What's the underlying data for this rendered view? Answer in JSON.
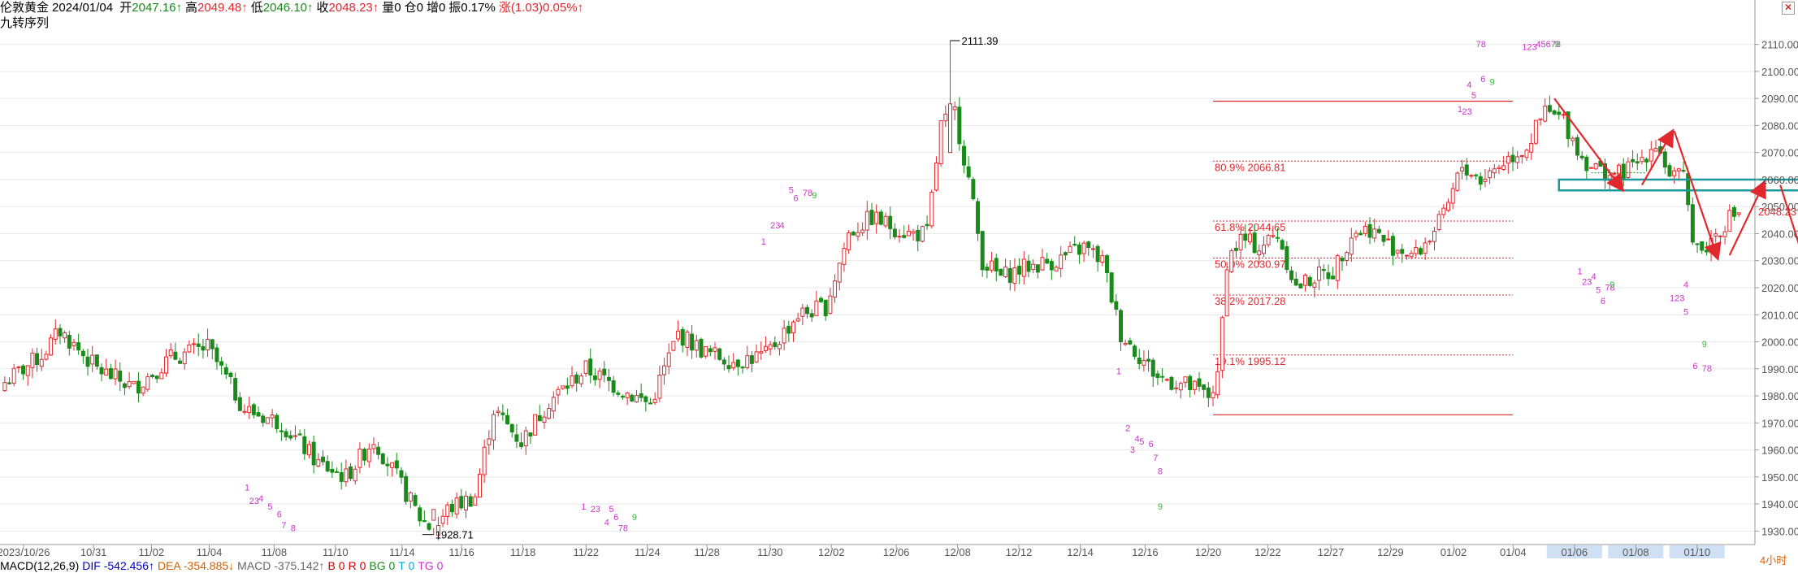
{
  "header": {
    "symbol": "伦敦黄金",
    "date": "2024/01/04",
    "open_label": "开",
    "open": "2047.16↑",
    "high_label": "高",
    "high": "2049.48↑",
    "low_label": "低",
    "low": "2046.10↑",
    "close_label": "收",
    "close": "2048.23↑",
    "volume": "量0",
    "oi": "仓0",
    "oi_change": "增0",
    "amplitude": "振0.17%",
    "change": "涨(1.03)0.05%↑"
  },
  "subtitle": "九转序列",
  "close_icon": "close-icon",
  "period_label": "4小时",
  "macd": {
    "title": "MACD(12,26,9)",
    "dif": "DIF -542.456↑",
    "dea": "DEA -354.885↓",
    "macd": "MACD -375.142↑",
    "b": "B 0",
    "r": "R 0",
    "bg": "BG 0",
    "t": "T 0",
    "tg": "TG 0"
  },
  "colors": {
    "up": "#e0282e",
    "down": "#1a8a1a",
    "fib": "#e0282e",
    "seq": "#cc33cc",
    "nine": "#33bb33",
    "box": "#1a9a9a",
    "price_tag": "#e0282e",
    "axis_text": "#555555"
  },
  "chart_data": {
    "type": "candlestick",
    "ylim": [
      1925,
      2118
    ],
    "y_ticks": [
      1930,
      1940,
      1950,
      1960,
      1970,
      1980,
      1990,
      2000,
      2010,
      2020,
      2030,
      2040,
      2050,
      2060,
      2070,
      2080,
      2090,
      2100,
      2110
    ],
    "x_ticks": [
      "2023/10/26",
      "10/31",
      "11/02",
      "11/04",
      "11/08",
      "11/10",
      "11/14",
      "11/16",
      "11/18",
      "11/22",
      "11/24",
      "11/28",
      "11/30",
      "12/02",
      "12/06",
      "12/08",
      "12/12",
      "12/14",
      "12/16",
      "12/20",
      "12/22",
      "12/27",
      "12/29",
      "01/02",
      "01/04",
      "01/06",
      "01/08",
      "01/10"
    ],
    "future_ticks": [
      "01/06",
      "01/08",
      "01/10"
    ],
    "last_price": "2048.23",
    "annotations": {
      "high": "2111.39",
      "low": "1928.71"
    },
    "fib_levels": [
      {
        "label": "80.9% 2066.81",
        "value": 2066.81
      },
      {
        "label": "61.8% 2044.65",
        "value": 2044.65
      },
      {
        "label": "50.0% 2030.97",
        "value": 2030.97
      },
      {
        "label": "38.2% 2017.28",
        "value": 2017.28
      },
      {
        "label": "19.1% 1995.12",
        "value": 1995.12
      }
    ],
    "fib_bounds": [
      2089.0,
      1973.0
    ],
    "resistance_zone": [
      2056,
      2060
    ],
    "anchors": [
      {
        "i": 0,
        "v": 1985
      },
      {
        "i": 8,
        "v": 1995
      },
      {
        "i": 12,
        "v": 2004
      },
      {
        "i": 20,
        "v": 1990
      },
      {
        "i": 28,
        "v": 1983
      },
      {
        "i": 36,
        "v": 1994
      },
      {
        "i": 44,
        "v": 1998
      },
      {
        "i": 52,
        "v": 1975
      },
      {
        "i": 60,
        "v": 1970
      },
      {
        "i": 68,
        "v": 1955
      },
      {
        "i": 74,
        "v": 1950
      },
      {
        "i": 80,
        "v": 1964
      },
      {
        "i": 86,
        "v": 1947
      },
      {
        "i": 90,
        "v": 1935
      },
      {
        "i": 93,
        "v": 1930
      },
      {
        "i": 96,
        "v": 1938
      },
      {
        "i": 102,
        "v": 1943
      },
      {
        "i": 106,
        "v": 1975
      },
      {
        "i": 112,
        "v": 1963
      },
      {
        "i": 118,
        "v": 1978
      },
      {
        "i": 126,
        "v": 1990
      },
      {
        "i": 134,
        "v": 1982
      },
      {
        "i": 140,
        "v": 1977
      },
      {
        "i": 146,
        "v": 2003
      },
      {
        "i": 152,
        "v": 1996
      },
      {
        "i": 158,
        "v": 1993
      },
      {
        "i": 165,
        "v": 1995
      },
      {
        "i": 172,
        "v": 2010
      },
      {
        "i": 178,
        "v": 2013
      },
      {
        "i": 183,
        "v": 2040
      },
      {
        "i": 188,
        "v": 2046
      },
      {
        "i": 196,
        "v": 2040
      },
      {
        "i": 200,
        "v": 2040
      },
      {
        "i": 203,
        "v": 2080
      },
      {
        "i": 206,
        "v": 2085
      },
      {
        "i": 209,
        "v": 2060
      },
      {
        "i": 212,
        "v": 2030
      },
      {
        "i": 216,
        "v": 2024
      },
      {
        "i": 222,
        "v": 2028
      },
      {
        "i": 228,
        "v": 2030
      },
      {
        "i": 234,
        "v": 2035
      },
      {
        "i": 238,
        "v": 2030
      },
      {
        "i": 242,
        "v": 2003
      },
      {
        "i": 246,
        "v": 1995
      },
      {
        "i": 250,
        "v": 1987
      },
      {
        "i": 256,
        "v": 1984
      },
      {
        "i": 261,
        "v": 1980
      },
      {
        "i": 263,
        "v": 1986
      },
      {
        "i": 265,
        "v": 2030
      },
      {
        "i": 268,
        "v": 2038
      },
      {
        "i": 272,
        "v": 2035
      },
      {
        "i": 276,
        "v": 2040
      },
      {
        "i": 280,
        "v": 2020
      },
      {
        "i": 284,
        "v": 2024
      },
      {
        "i": 288,
        "v": 2026
      },
      {
        "i": 292,
        "v": 2040
      },
      {
        "i": 296,
        "v": 2042
      },
      {
        "i": 300,
        "v": 2036
      },
      {
        "i": 306,
        "v": 2032
      },
      {
        "i": 312,
        "v": 2046
      },
      {
        "i": 316,
        "v": 2065
      },
      {
        "i": 320,
        "v": 2060
      },
      {
        "i": 326,
        "v": 2068
      },
      {
        "i": 330,
        "v": 2072
      },
      {
        "i": 334,
        "v": 2085
      },
      {
        "i": 338,
        "v": 2082
      },
      {
        "i": 342,
        "v": 2068
      },
      {
        "i": 346,
        "v": 2063
      },
      {
        "i": 350,
        "v": 2062
      },
      {
        "i": 354,
        "v": 2066
      },
      {
        "i": 358,
        "v": 2074
      },
      {
        "i": 361,
        "v": 2062
      },
      {
        "i": 364,
        "v": 2060
      },
      {
        "i": 366,
        "v": 2040
      },
      {
        "i": 368,
        "v": 2033
      },
      {
        "i": 371,
        "v": 2040
      },
      {
        "i": 374,
        "v": 2046
      },
      {
        "i": 376,
        "v": 2048.23
      }
    ],
    "seq_labels": [
      {
        "t": "1",
        "i": 52,
        "v": 1945
      },
      {
        "t": "23",
        "i": 53,
        "v": 1940
      },
      {
        "t": "4",
        "i": 55,
        "v": 1941
      },
      {
        "t": "5",
        "i": 57,
        "v": 1938
      },
      {
        "t": "6",
        "i": 59,
        "v": 1935
      },
      {
        "t": "7",
        "i": 60,
        "v": 1931
      },
      {
        "t": "8",
        "i": 62,
        "v": 1930
      },
      {
        "t": "1",
        "i": 125,
        "v": 1938
      },
      {
        "t": "23",
        "i": 127,
        "v": 1937
      },
      {
        "t": "5",
        "i": 131,
        "v": 1937
      },
      {
        "t": "4",
        "i": 130,
        "v": 1932
      },
      {
        "t": "6",
        "i": 132,
        "v": 1934
      },
      {
        "t": "78",
        "i": 133,
        "v": 1930
      },
      {
        "t": "9",
        "i": 136,
        "v": 1934
      },
      {
        "t": "1",
        "i": 164,
        "v": 2036
      },
      {
        "t": "23",
        "i": 166,
        "v": 2042
      },
      {
        "t": "4",
        "i": 168,
        "v": 2042
      },
      {
        "t": "5",
        "i": 170,
        "v": 2055
      },
      {
        "t": "6",
        "i": 171,
        "v": 2052
      },
      {
        "t": "78",
        "i": 173,
        "v": 2054
      },
      {
        "t": "9",
        "i": 175,
        "v": 2053
      },
      {
        "t": "1",
        "i": 241,
        "v": 1988
      },
      {
        "t": "2",
        "i": 243,
        "v": 1967
      },
      {
        "t": "4",
        "i": 245,
        "v": 1963
      },
      {
        "t": "3",
        "i": 244,
        "v": 1959
      },
      {
        "t": "5",
        "i": 246,
        "v": 1962
      },
      {
        "t": "6",
        "i": 248,
        "v": 1961
      },
      {
        "t": "7",
        "i": 249,
        "v": 1956
      },
      {
        "t": "8",
        "i": 250,
        "v": 1951
      },
      {
        "t": "9",
        "i": 250,
        "v": 1938
      },
      {
        "t": "1",
        "i": 315,
        "v": 2085
      },
      {
        "t": "23",
        "i": 316,
        "v": 2084
      },
      {
        "t": "4",
        "i": 317,
        "v": 2094
      },
      {
        "t": "5",
        "i": 318,
        "v": 2090
      },
      {
        "t": "6",
        "i": 320,
        "v": 2096
      },
      {
        "t": "9",
        "i": 322,
        "v": 2095
      },
      {
        "t": "78",
        "i": 319,
        "v": 2109
      },
      {
        "t": "123",
        "i": 329,
        "v": 2108
      },
      {
        "t": "45678",
        "i": 332,
        "v": 2109
      },
      {
        "t": "9",
        "i": 336,
        "v": 2109
      },
      {
        "t": "1",
        "i": 341,
        "v": 2025
      },
      {
        "t": "23",
        "i": 342,
        "v": 2021
      },
      {
        "t": "4",
        "i": 344,
        "v": 2023
      },
      {
        "t": "5",
        "i": 345,
        "v": 2018
      },
      {
        "t": "6",
        "i": 346,
        "v": 2014
      },
      {
        "t": "78",
        "i": 347,
        "v": 2019
      },
      {
        "t": "9",
        "i": 348,
        "v": 2020
      },
      {
        "t": "4",
        "i": 364,
        "v": 2020
      },
      {
        "t": "123",
        "i": 361,
        "v": 2015
      },
      {
        "t": "5",
        "i": 364,
        "v": 2010
      },
      {
        "t": "9",
        "i": 368,
        "v": 1998
      },
      {
        "t": "6",
        "i": 366,
        "v": 1990
      },
      {
        "t": "78",
        "i": 368,
        "v": 1989
      }
    ]
  }
}
